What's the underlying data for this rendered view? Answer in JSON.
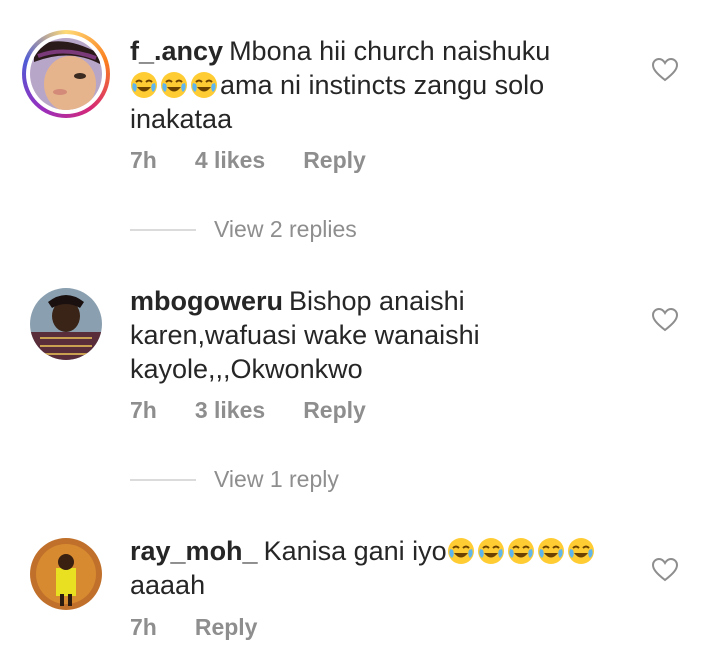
{
  "comments": [
    {
      "username": "f_.ancy",
      "text": "Mbona hii church naishuku",
      "text_after_emoji": "ama ni instincts zangu solo",
      "text_line3": "inakataa",
      "emoji_count": 3,
      "time": "7h",
      "likes": "4 likes",
      "reply_label": "Reply",
      "view_replies": "View 2 replies"
    },
    {
      "username": "mbogoweru",
      "text": "Bishop anaishi",
      "text_line2": "karen,wafuasi wake wanaishi",
      "text_line3": "kayole,,,Okwonkwo",
      "time": "7h",
      "likes": "3 likes",
      "reply_label": "Reply",
      "view_replies": "View 1 reply"
    },
    {
      "username": "ray_moh_",
      "text": "Kanisa gani iyo",
      "text_line2": "aaaah",
      "emoji_count": 5,
      "time": "7h",
      "reply_label": "Reply"
    }
  ],
  "icons": {
    "like": "heart-outline-icon",
    "emoji": "face-with-tears-of-joy"
  },
  "colors": {
    "text": "#262626",
    "meta": "#8e8e8e",
    "divider": "#dbdbdb"
  }
}
